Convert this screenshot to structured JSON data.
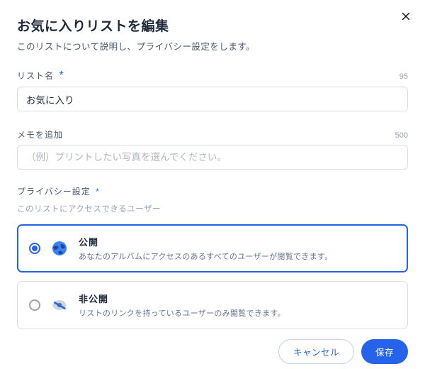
{
  "header": {
    "title": "お気に入りリストを編集",
    "subtitle": "このリストについて説明し、プライバシー設定をします。"
  },
  "fields": {
    "name": {
      "label": "リスト名",
      "required_marker": "*",
      "value": "お気に入り",
      "remaining": "95"
    },
    "memo": {
      "label": "メモを追加",
      "placeholder": "（例）プリントしたい写真を選んでください。",
      "remaining": "500"
    }
  },
  "privacy": {
    "label": "プライバシー設定",
    "required_marker": "*",
    "sublabel": "このリストにアクセスできるユーザー",
    "options": {
      "public": {
        "title": "公開",
        "desc": "あなたのアルバムにアクセスのあるすべてのユーザーが閲覧できます。",
        "selected": true
      },
      "private": {
        "title": "非公開",
        "desc": "リストのリンクを持っているユーザーのみ閲覧できます。",
        "selected": false
      }
    }
  },
  "footer": {
    "cancel": "キャンセル",
    "save": "保存"
  }
}
